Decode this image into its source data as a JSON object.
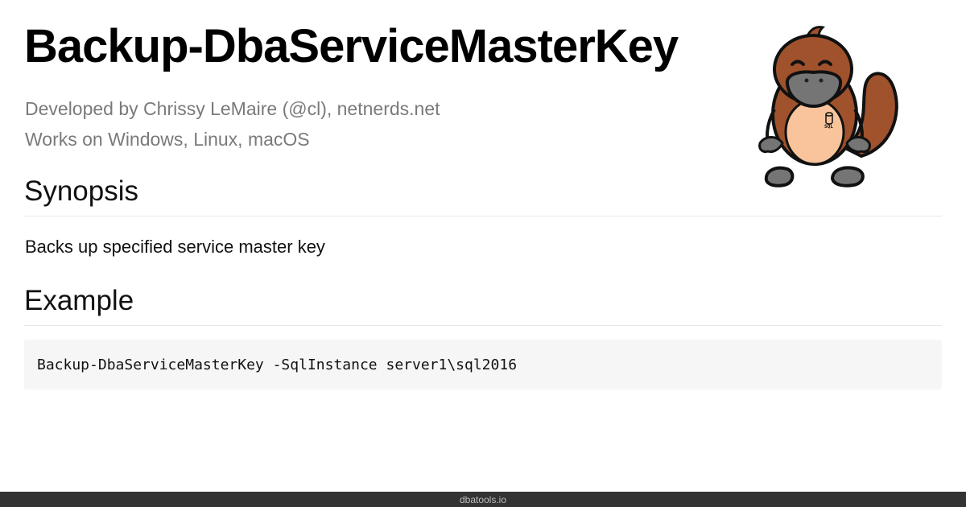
{
  "page": {
    "title": "Backup-DbaServiceMasterKey",
    "developed_by": "Developed by Chrissy LeMaire (@cl), netnerds.net",
    "works_on": "Works on Windows, Linux, macOS"
  },
  "mascot": {
    "icon": "platypus-mascot-icon",
    "badge_text": "SQL"
  },
  "synopsis": {
    "heading": "Synopsis",
    "text": "Backs up specified service master key"
  },
  "example": {
    "heading": "Example",
    "code": "Backup-DbaServiceMasterKey -SqlInstance server1\\sql2016"
  },
  "footer": {
    "text": "dbatools.io"
  },
  "colors": {
    "mascot_body": "#a0522d",
    "mascot_belly": "#f9c49c",
    "mascot_bill": "#757575",
    "footer_bg": "#333333",
    "code_bg": "#f6f6f6"
  }
}
